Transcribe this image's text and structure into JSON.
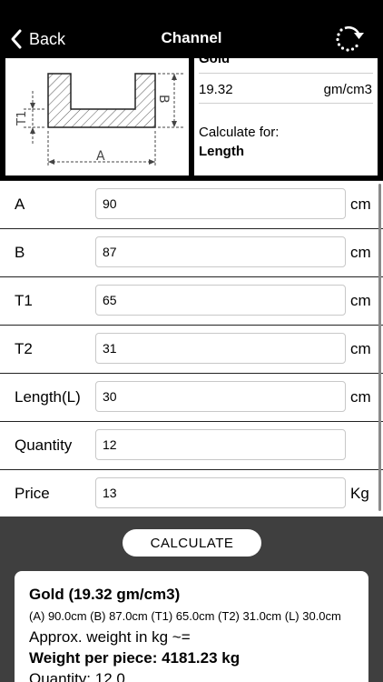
{
  "nav": {
    "back_label": "Back",
    "title": "Channel"
  },
  "diagram": {
    "label_a": "A",
    "label_b": "B",
    "label_t1": "T1"
  },
  "info": {
    "material": "Gold",
    "density_value": "19.32",
    "density_unit": "gm/cm3",
    "calculate_for_label": "Calculate for:",
    "calculate_for_value": "Length"
  },
  "form": {
    "rows": [
      {
        "label": "A",
        "value": "90",
        "unit": "cm"
      },
      {
        "label": "B",
        "value": "87",
        "unit": "cm"
      },
      {
        "label": "T1",
        "value": "65",
        "unit": "cm"
      },
      {
        "label": "T2",
        "value": "31",
        "unit": "cm"
      },
      {
        "label": "Length(L)",
        "value": "30",
        "unit": "cm"
      },
      {
        "label": "Quantity",
        "value": "12",
        "unit": ""
      },
      {
        "label": "Price",
        "value": "13",
        "unit": "Kg"
      }
    ]
  },
  "calculate_button": "CALCULATE",
  "result": {
    "title": "Gold (19.32 gm/cm3)",
    "dimensions": "(A) 90.0cm (B) 87.0cm (T1) 65.0cm (T2) 31.0cm (L) 30.0cm",
    "approx": "Approx. weight in kg ~=",
    "weight_per_piece": "Weight per piece: 4181.23 kg",
    "quantity": "Quantity: 12.0"
  }
}
